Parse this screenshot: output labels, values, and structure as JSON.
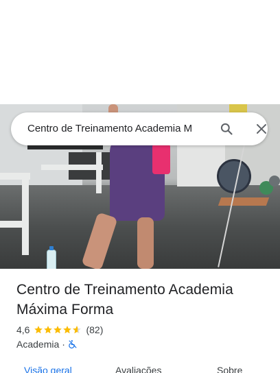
{
  "search": {
    "query": "Centro de Treinamento Academia M"
  },
  "icons": {
    "search": "search-icon",
    "close": "close-icon",
    "accessibility": "not-wheelchair-accessible-icon"
  },
  "place": {
    "title_line1": "Centro de Treinamento Academia",
    "title_line2": "Máxima Forma",
    "rating": "4,6",
    "stars": 4.6,
    "reviews": "(82)",
    "category": "Academia",
    "separator": "·"
  },
  "tabs": [
    {
      "label": "Visão geral",
      "active": true
    },
    {
      "label": "Avaliações",
      "active": false
    },
    {
      "label": "Sobre",
      "active": false
    }
  ],
  "colors": {
    "accent": "#1a73e8",
    "star": "#fbbc04"
  }
}
